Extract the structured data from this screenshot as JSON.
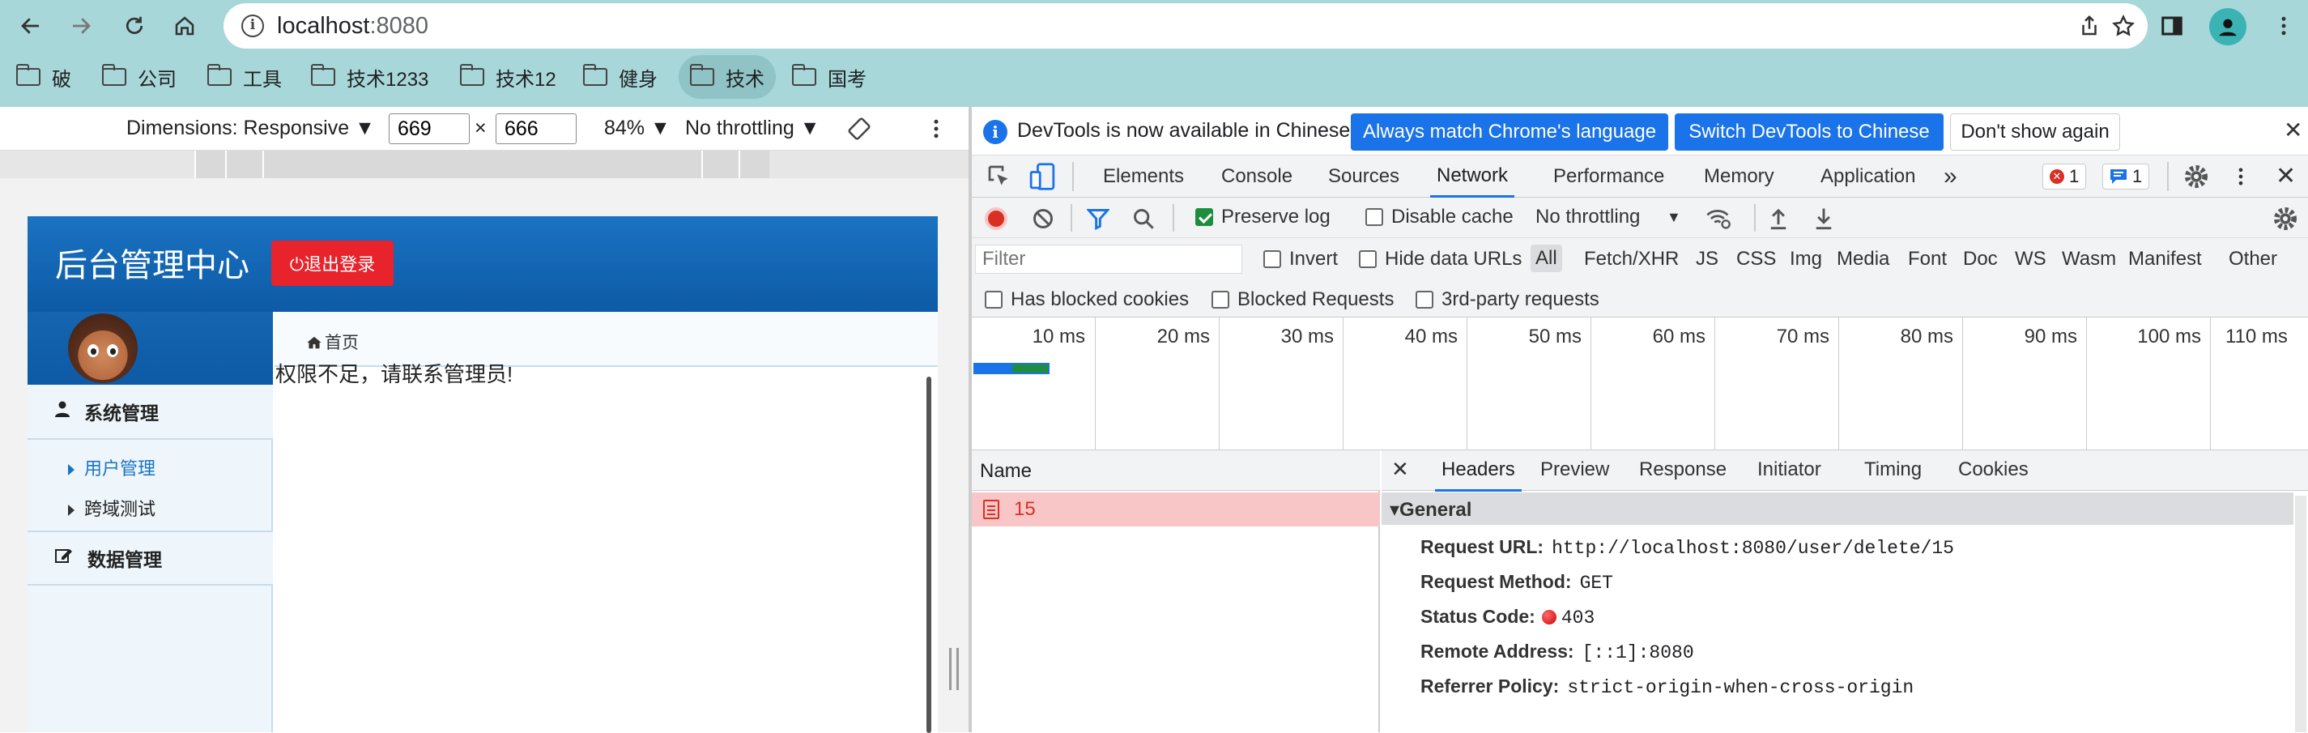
{
  "browser": {
    "url_host": "localhost",
    "url_port": ":8080",
    "bookmarks": [
      {
        "label": "破"
      },
      {
        "label": "公司"
      },
      {
        "label": "工具"
      },
      {
        "label": "技术1233"
      },
      {
        "label": "技术12"
      },
      {
        "label": "健身"
      },
      {
        "label": "技术"
      },
      {
        "label": "国考"
      }
    ]
  },
  "device_toolbar": {
    "dimensions_label": "Dimensions: Responsive ▼",
    "width": "669",
    "times": "×",
    "height": "666",
    "zoom": "84% ▼",
    "throttling": "No throttling ▼"
  },
  "site": {
    "title": "后台管理中心",
    "logout": "⏻退出登录",
    "menu": {
      "system": "系统管理",
      "user_mgmt": "用户管理",
      "cors_test": "跨域测试",
      "data": "数据管理"
    },
    "breadcrumb": "首页",
    "message": "权限不足，请联系管理员!"
  },
  "devtools": {
    "info_text": "DevTools is now available in Chinese!",
    "btn_match": "Always match Chrome's language",
    "btn_switch": "Switch DevTools to Chinese",
    "btn_dont": "Don't show again",
    "tabs": [
      "Elements",
      "Console",
      "Sources",
      "Network",
      "Performance",
      "Memory",
      "Application"
    ],
    "more_tabs": "»",
    "error_count": "1",
    "message_count": "1",
    "toolbar": {
      "preserve_log": "Preserve log",
      "disable_cache": "Disable cache",
      "throttling": "No throttling"
    },
    "filter_placeholder": "Filter",
    "filters": {
      "invert": "Invert",
      "hide_data_urls": "Hide data URLs",
      "types": [
        "All",
        "Fetch/XHR",
        "JS",
        "CSS",
        "Img",
        "Media",
        "Font",
        "Doc",
        "WS",
        "Wasm",
        "Manifest",
        "Other"
      ]
    },
    "blocked": {
      "has_blocked_cookies": "Has blocked cookies",
      "blocked_requests": "Blocked Requests",
      "third_party": "3rd-party requests"
    },
    "timeline_ticks": [
      "10 ms",
      "20 ms",
      "30 ms",
      "40 ms",
      "50 ms",
      "60 ms",
      "70 ms",
      "80 ms",
      "90 ms",
      "100 ms",
      "110 ms"
    ],
    "name_header": "Name",
    "request_name": "15",
    "detail_tabs": [
      "Headers",
      "Preview",
      "Response",
      "Initiator",
      "Timing",
      "Cookies"
    ],
    "general_label": "▾General",
    "general": {
      "request_url_k": "Request URL:",
      "request_url_v": "http://localhost:8080/user/delete/15",
      "method_k": "Request Method:",
      "method_v": "GET",
      "status_k": "Status Code:",
      "status_v": "403",
      "remote_k": "Remote Address:",
      "remote_v": "[::1]:8080",
      "referrer_k": "Referrer Policy:",
      "referrer_v": "strict-origin-when-cross-origin"
    }
  },
  "colors": {
    "toolbar_bg": "#a8d7d9",
    "site_header": "#1a73c2",
    "logout_red": "#e8232b",
    "devtools_blue": "#1a73e8",
    "error_row": "#f8c6c6"
  }
}
